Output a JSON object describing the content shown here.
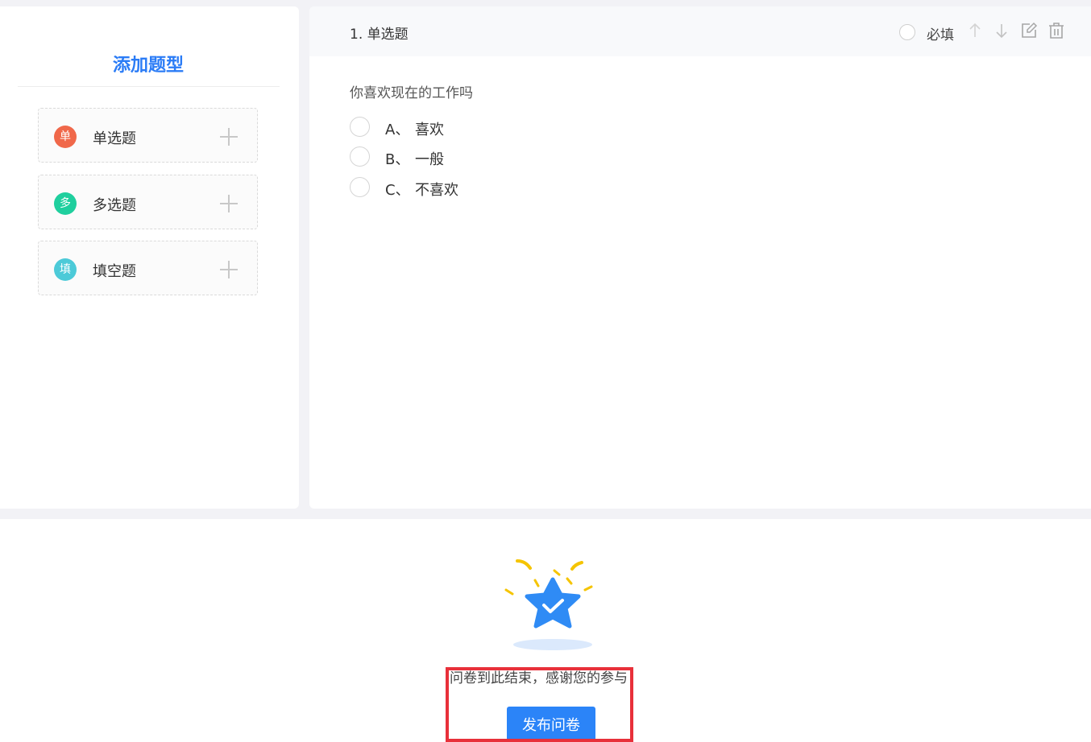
{
  "sidebar": {
    "title": "添加题型",
    "items": [
      {
        "badge": "单",
        "label": "单选题",
        "color": "#f0684a"
      },
      {
        "badge": "多",
        "label": "多选题",
        "color": "#1fcf9e"
      },
      {
        "badge": "填",
        "label": "填空题",
        "color": "#4ccad8"
      }
    ]
  },
  "question": {
    "header_title": "1. 单选题",
    "required_label": "必填",
    "text": "你喜欢现在的工作吗",
    "options": [
      {
        "letter": "A、",
        "text": "喜欢"
      },
      {
        "letter": "B、",
        "text": "一般"
      },
      {
        "letter": "C、",
        "text": "不喜欢"
      }
    ]
  },
  "footer": {
    "end_message": "问卷到此结束，感谢您的参与！",
    "publish_label": "发布问卷"
  },
  "colors": {
    "accent": "#2b84f8",
    "highlight": "#e8303a"
  }
}
